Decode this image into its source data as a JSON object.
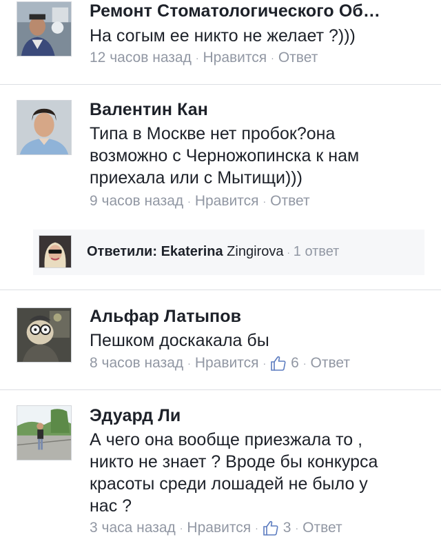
{
  "comments": [
    {
      "author": "Ремонт Стоматологического Об…",
      "text_lines": [
        "На согым ее никто не желает ?)))"
      ],
      "time": "12 часов назад",
      "like_label": "Нравится",
      "reply_label": "Ответ",
      "likes": null,
      "avatar_icon": "person-in-dental-office-photo"
    },
    {
      "author": "Валентин Кан",
      "text_lines": [
        "Типа в Москве нет пробок?она",
        "возможно с Черножопинска к нам",
        "приехала или с Мытищи)))"
      ],
      "time": "9 часов назад",
      "like_label": "Нравится",
      "reply_label": "Ответ",
      "likes": null,
      "avatar_icon": "man-portrait-photo"
    },
    {
      "author": "Альфар Латыпов",
      "text_lines": [
        "Пешком доскакала бы"
      ],
      "time": "8 часов назад",
      "like_label": "Нравится",
      "reply_label": "Ответ",
      "likes": "6",
      "avatar_icon": "cartoon-character-photo"
    },
    {
      "author": "Эдуард Ли",
      "text_lines": [
        "А чего она вообще приезжала то ,",
        "никто не знает ? Вроде бы конкурса",
        "красоты среди лошадей не было у",
        "нас ?"
      ],
      "time": "3 часа назад",
      "like_label": "Нравится",
      "reply_label": "Ответ",
      "likes": "3",
      "avatar_icon": "man-outdoors-photo"
    }
  ],
  "reply_summary": {
    "prefix": "Ответили: ",
    "name_bold": "Ekaterina",
    "name_rest": " Zingirova",
    "count": "1 ответ",
    "avatar_icon": "woman-sunglasses-photo"
  },
  "separator": "·",
  "colors": {
    "text": "#1d2129",
    "meta": "#9197a3",
    "divider": "#dcdee3",
    "reply_bg": "#f6f7f9"
  }
}
